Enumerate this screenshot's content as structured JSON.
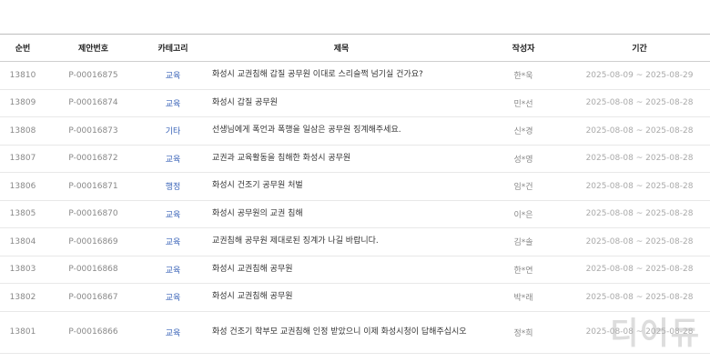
{
  "headers": {
    "no": "순번",
    "proposal_no": "제안번호",
    "category": "카테고리",
    "title": "제목",
    "author": "작성자",
    "period": "기간"
  },
  "rows": [
    {
      "no": "13810",
      "proposal_no": "P-00016875",
      "category": "교육",
      "title": "화성시 교권침해 갑질 공무원 이대로 스리슬쩍 넘기실 건가요?",
      "author": "한*욱",
      "period": "2025-08-09 ~ 2025-08-29"
    },
    {
      "no": "13809",
      "proposal_no": "P-00016874",
      "category": "교육",
      "title": "화성시 갑질 공무원",
      "author": "민*선",
      "period": "2025-08-08 ~ 2025-08-28"
    },
    {
      "no": "13808",
      "proposal_no": "P-00016873",
      "category": "기타",
      "title": "선생님에게 폭언과 폭행을 일삼은 공무원 징계해주세요.",
      "author": "신*경",
      "period": "2025-08-08 ~ 2025-08-28"
    },
    {
      "no": "13807",
      "proposal_no": "P-00016872",
      "category": "교육",
      "title": "교권과 교육활동을 침해한 화성시 공무원",
      "author": "성*영",
      "period": "2025-08-08 ~ 2025-08-28"
    },
    {
      "no": "13806",
      "proposal_no": "P-00016871",
      "category": "행정",
      "title": "화성시 건조기 공무원 처벌",
      "author": "임*건",
      "period": "2025-08-08 ~ 2025-08-28"
    },
    {
      "no": "13805",
      "proposal_no": "P-00016870",
      "category": "교육",
      "title": "화성시 공무원의 교권 침해",
      "author": "이*은",
      "period": "2025-08-08 ~ 2025-08-28"
    },
    {
      "no": "13804",
      "proposal_no": "P-00016869",
      "category": "교육",
      "title": "교권침해 공무원 제대로된 징계가 나길 바랍니다.",
      "author": "김*솔",
      "period": "2025-08-08 ~ 2025-08-28"
    },
    {
      "no": "13803",
      "proposal_no": "P-00016868",
      "category": "교육",
      "title": "화성시 교권침해 공무원",
      "author": "한*연",
      "period": "2025-08-08 ~ 2025-08-28"
    },
    {
      "no": "13802",
      "proposal_no": "P-00016867",
      "category": "교육",
      "title": "화성시 교권침해 공무원",
      "author": "박*래",
      "period": "2025-08-08 ~ 2025-08-28"
    },
    {
      "no": "13801",
      "proposal_no": "P-00016866",
      "category": "교육",
      "title": "화성 건조기 학부모 교권침해 인정 받았으니 이제 화성시청이 답해주십시오",
      "author": "정*희",
      "period": "2025-08-08 ~ 2025-08-28"
    }
  ],
  "watermark": "디어듀"
}
